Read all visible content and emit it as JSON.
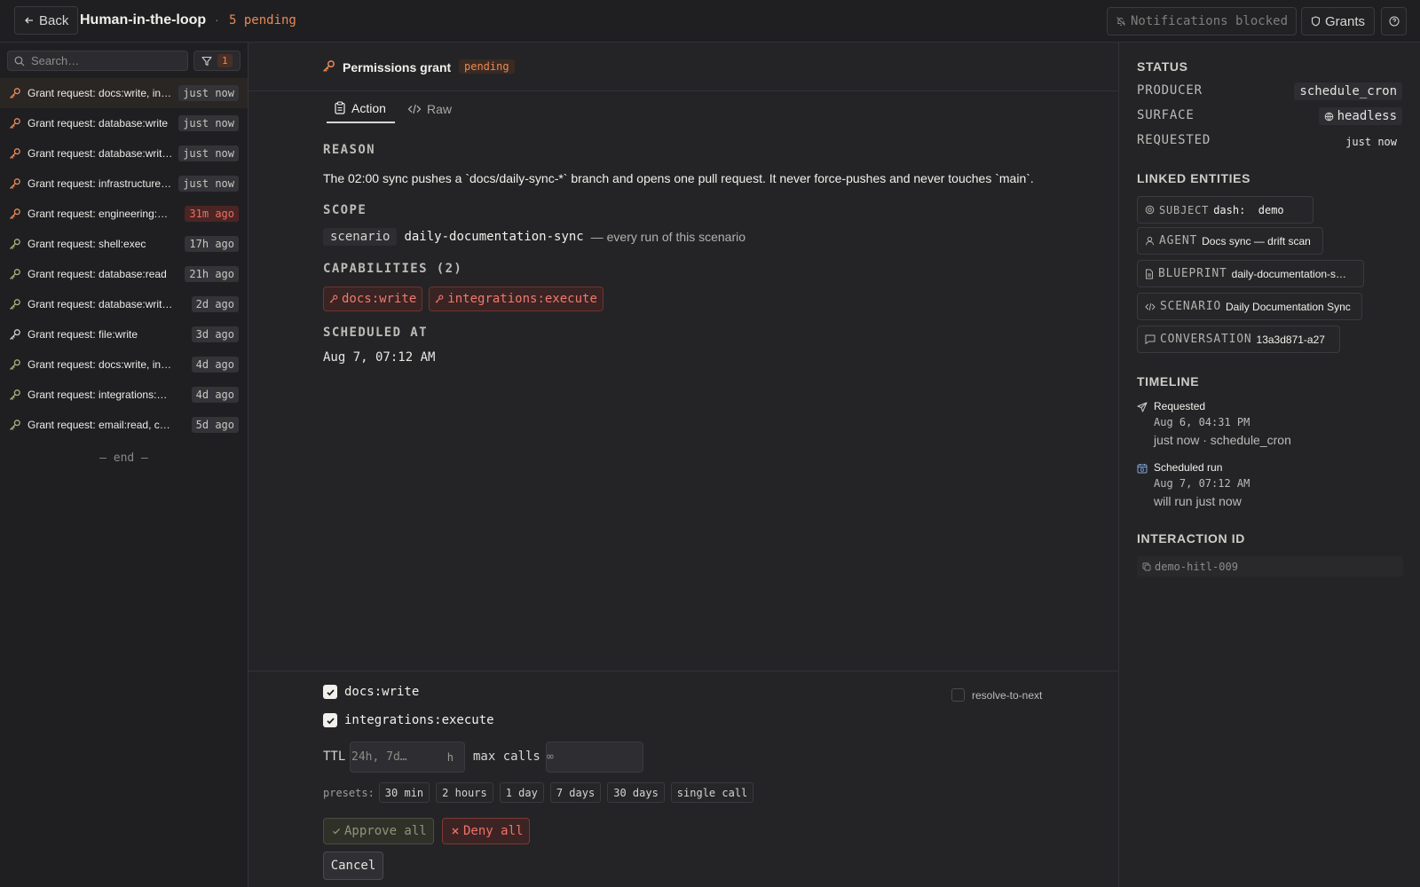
{
  "topbar": {
    "back_label": "Back",
    "title": "Human-in-the-loop",
    "separator": "·",
    "pending": "5 pending",
    "notifications_label": "Notifications blocked",
    "grants_label": "Grants"
  },
  "sidebar": {
    "search_placeholder": "Search…",
    "filter_count": "1",
    "items": [
      {
        "label": "Grant request: docs:write, integrations:execute",
        "time": "just now",
        "hot": false,
        "accent": "#e98a57"
      },
      {
        "label": "Grant request: database:write",
        "time": "just now",
        "hot": false,
        "accent": "#e98a57"
      },
      {
        "label": "Grant request: database:write, file:write",
        "time": "just now",
        "hot": false,
        "accent": "#e98a57"
      },
      {
        "label": "Grant request: infrastructure:deploy",
        "time": "just now",
        "hot": false,
        "accent": "#e98a57"
      },
      {
        "label": "Grant request: engineering:execute",
        "time": "31m ago",
        "hot": true,
        "accent": "#e98a57"
      },
      {
        "label": "Grant request: shell:exec",
        "time": "17h ago",
        "hot": false,
        "accent": "#a6b37a"
      },
      {
        "label": "Grant request: database:read",
        "time": "21h ago",
        "hot": false,
        "accent": "#a6b37a"
      },
      {
        "label": "Grant request: database:write, file:write",
        "time": "2d ago",
        "hot": false,
        "accent": "#a6b37a"
      },
      {
        "label": "Grant request: file:write",
        "time": "3d ago",
        "hot": false,
        "accent": "#cfcdc7"
      },
      {
        "label": "Grant request: docs:write, integrations:execute",
        "time": "4d ago",
        "hot": false,
        "accent": "#a6b37a"
      },
      {
        "label": "Grant request: integrations:execute",
        "time": "4d ago",
        "hot": false,
        "accent": "#a6b37a"
      },
      {
        "label": "Grant request: email:read, calendar:write",
        "time": "5d ago",
        "hot": false,
        "accent": "#a6b37a"
      }
    ],
    "end_label": "— end —"
  },
  "main": {
    "header_title": "Permissions grant",
    "header_badge": "pending",
    "tabs": [
      {
        "label": "Action",
        "active": true
      },
      {
        "label": "Raw",
        "active": false
      }
    ],
    "reason_label": "REASON",
    "reason_text": "The 02:00 sync pushes a `docs/daily-sync-*` branch and opens one pull request. It never force-pushes and never touches `main`.",
    "scope_label": "SCOPE",
    "scope_kind": "scenario",
    "scope_name": "daily-documentation-sync",
    "scope_desc": "— every run of this scenario",
    "capabilities_label": "CAPABILITIES (2)",
    "capabilities": [
      "docs:write",
      "integrations:execute"
    ],
    "scheduled_label": "SCHEDULED AT",
    "scheduled_value": "Aug 7, 07:12 AM"
  },
  "footer": {
    "checks": [
      {
        "label": "docs:write",
        "checked": true
      },
      {
        "label": "integrations:execute",
        "checked": true
      }
    ],
    "resolve_label": "resolve-to-next",
    "ttl_label": "TTL",
    "ttl_placeholder": "24h, 7d…",
    "ttl_unit": "h",
    "max_calls_label": "max calls",
    "max_calls_placeholder": "∞",
    "presets_label": "presets:",
    "presets": [
      "30 min",
      "2 hours",
      "1 day",
      "7 days",
      "30 days",
      "single call"
    ],
    "approve_label": "Approve all",
    "deny_label": "Deny all",
    "cancel_label": "Cancel"
  },
  "details": {
    "status_head": "STATUS",
    "producer_key": "PRODUCER",
    "producer_val": "schedule_cron",
    "surface_key": "SURFACE",
    "surface_val": "headless",
    "requested_key": "REQUESTED",
    "requested_val": "just now",
    "linked_head": "LINKED ENTITIES",
    "entities": [
      {
        "type": "SUBJECT",
        "value": "dash:  demo",
        "icon": "target-icon"
      },
      {
        "type": "AGENT",
        "value": "Docs sync — drift scan",
        "icon": "user-icon"
      },
      {
        "type": "BLUEPRINT",
        "value": "daily-documentation-sync",
        "icon": "file-icon"
      },
      {
        "type": "SCENARIO",
        "value": "Daily Documentation Sync",
        "icon": "code-icon"
      },
      {
        "type": "CONVERSATION",
        "value": "13a3d871-a27",
        "icon": "chat-icon"
      }
    ],
    "timeline_head": "TIMELINE",
    "timeline": [
      {
        "title": "Requested",
        "time": "Aug 6, 04:31 PM",
        "desc": "just now · schedule_cron"
      },
      {
        "title": "Scheduled run",
        "time": "Aug 7, 07:12 AM",
        "desc": "will run just now"
      }
    ],
    "interaction_head": "INTERACTION ID",
    "interaction_id": "demo-hitl-009"
  }
}
